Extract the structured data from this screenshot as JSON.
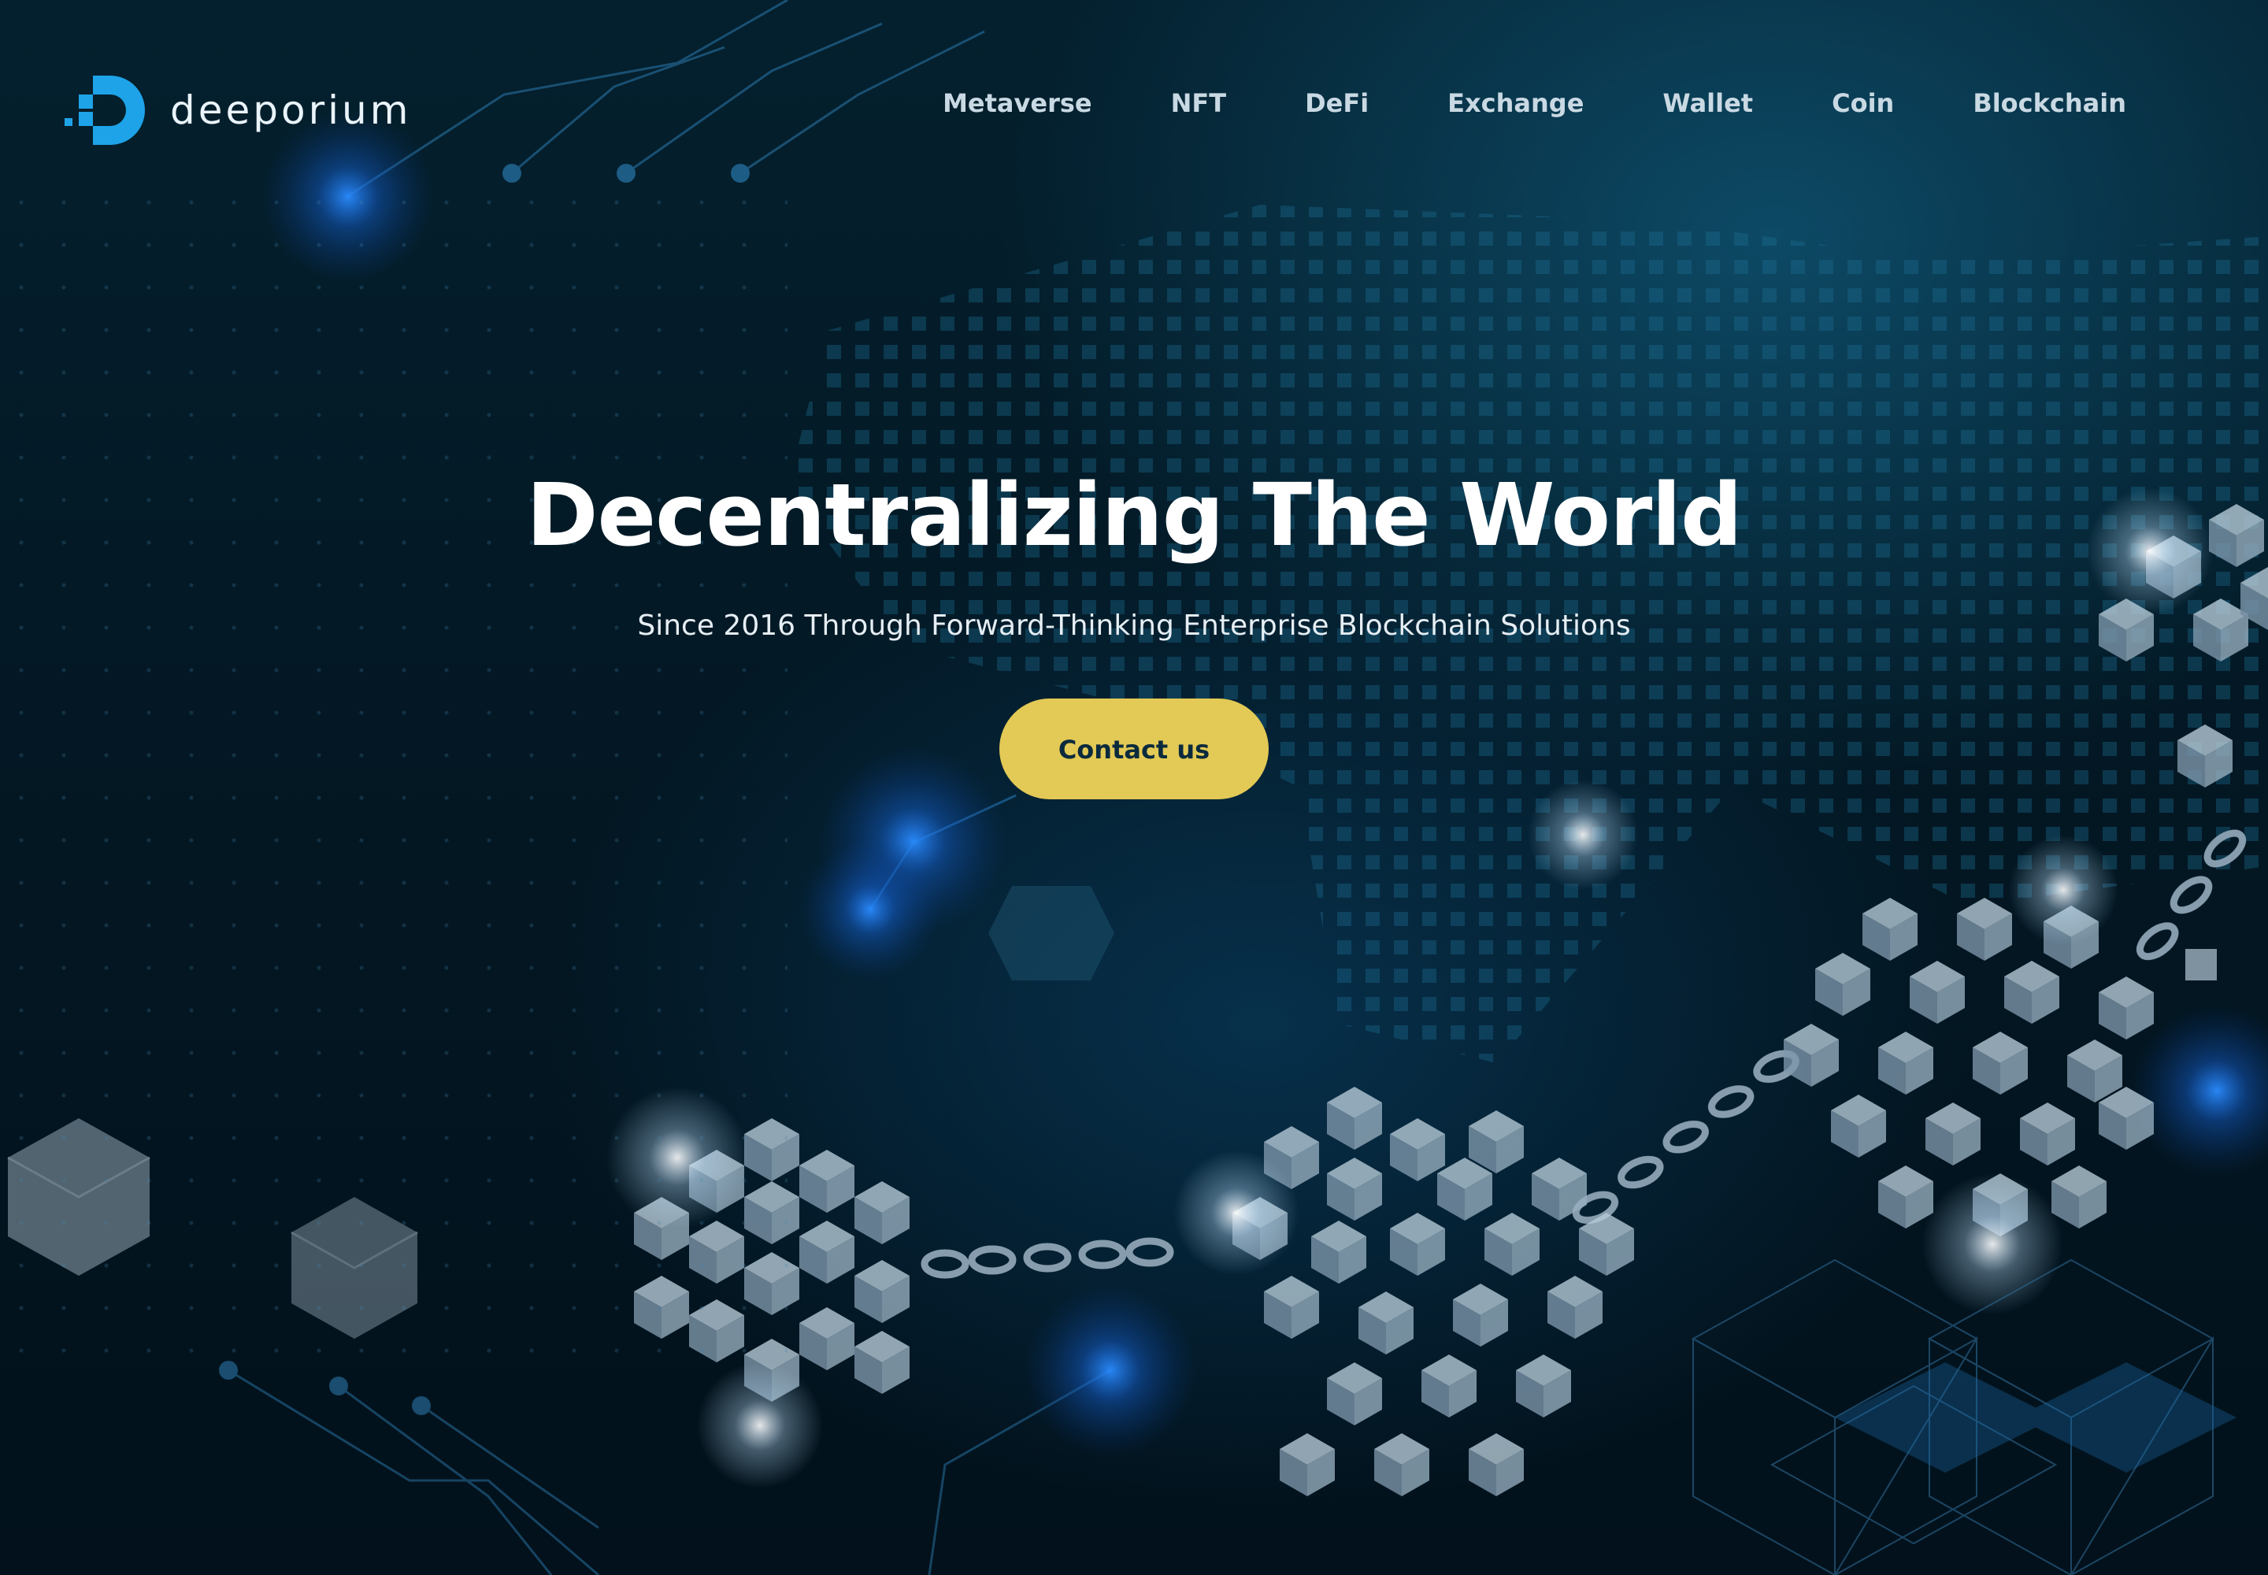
{
  "brand": {
    "name": "deeporium",
    "logo_icon": "pixel-d-logo-icon",
    "accent_color": "#1ea3e8"
  },
  "nav": {
    "items": [
      {
        "label": "Metaverse"
      },
      {
        "label": "NFT"
      },
      {
        "label": "DeFi"
      },
      {
        "label": "Exchange"
      },
      {
        "label": "Wallet"
      },
      {
        "label": "Coin"
      },
      {
        "label": "Blockchain"
      }
    ]
  },
  "hero": {
    "title": "Decentralizing The World",
    "subtitle": "Since 2016 Through Forward-Thinking Enterprise Blockchain Solutions",
    "cta_label": "Contact us",
    "cta_color": "#e3c955"
  },
  "background": {
    "theme": "blockchain-cubes-and-chains",
    "base_color": "#04121d"
  }
}
